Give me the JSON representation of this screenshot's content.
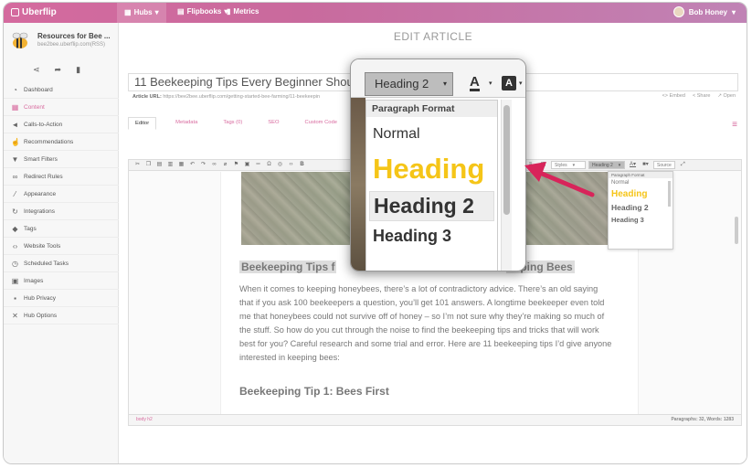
{
  "topbar": {
    "brand": "Uberflip",
    "nav": [
      {
        "label": "Hubs"
      },
      {
        "label": "Flipbooks"
      },
      {
        "label": "Metrics"
      }
    ],
    "user_name": "Bob Honey"
  },
  "sidebar": {
    "hub_title": "Resources for Bee ...",
    "hub_url": "bee2bee.uberflip.com(RSS)",
    "items": [
      {
        "label": "Dashboard",
        "icon": "dashboard-icon"
      },
      {
        "label": "Content",
        "icon": "grid-icon",
        "active": true
      },
      {
        "label": "Calls-to-Action",
        "icon": "megaphone-icon"
      },
      {
        "label": "Recommendations",
        "icon": "thumbs-up-icon"
      },
      {
        "label": "Smart Filters",
        "icon": "filter-icon"
      },
      {
        "label": "Redirect Rules",
        "icon": "link-icon"
      },
      {
        "label": "Appearance",
        "icon": "brush-icon"
      },
      {
        "label": "Integrations",
        "icon": "sync-icon"
      },
      {
        "label": "Tags",
        "icon": "tag-icon"
      },
      {
        "label": "Website Tools",
        "icon": "code-icon"
      },
      {
        "label": "Scheduled Tasks",
        "icon": "clock-icon"
      },
      {
        "label": "Images",
        "icon": "image-icon"
      },
      {
        "label": "Hub Privacy",
        "icon": "lock-icon"
      },
      {
        "label": "Hub Options",
        "icon": "wrench-icon"
      }
    ]
  },
  "main": {
    "page_title": "EDIT ARTICLE",
    "article_title": "11 Beekeeping Tips Every Beginner Shou",
    "url_label": "Article URL:",
    "url_value": "https://bee2bee.uberflip.com/getting-started-bee-farming/11-beekeepin",
    "url_actions": [
      "<> Embed",
      "< Share",
      "↗ Open"
    ],
    "tabs": [
      {
        "label": "Editor",
        "active": true
      },
      {
        "label": "Metadata"
      },
      {
        "label": "Tags (0)"
      },
      {
        "label": "SEO"
      },
      {
        "label": "Custom Code"
      }
    ],
    "toolbar": {
      "styles_label": "Styles",
      "format_label": "Heading 2",
      "source_label": "Source"
    },
    "mini_dropdown": {
      "header": "Paragraph Format",
      "options": [
        "Normal",
        "Heading",
        "Heading 2",
        "Heading 3"
      ]
    },
    "content": {
      "heading_left": "Beekeeping Tips f",
      "heading_right": "eeping Bees",
      "paragraph": "When it comes to keeping honeybees, there’s a lot of contradictory advice. There’s an old saying that if you ask 100 beekeepers a question, you’ll get 101 answers. A longtime beekeeper even told me that honeybees could not survive off of honey – so I’m not sure why they’re making so much of the stuff. So how do you cut through the noise to find the beekeeping tips and tricks that will work best for you? Careful research and some trial and error. Here are 11 beekeeping tips I’d give anyone interested in keeping bees:",
      "heading_tip1": "Beekeeping Tip 1: Bees First"
    },
    "status": {
      "path": "body   h2",
      "stats": "Paragraphs: 32, Words: 1283"
    }
  },
  "zoom": {
    "combo_label": "Heading 2",
    "header": "Paragraph Format",
    "options": [
      "Normal",
      "Heading",
      "Heading 2",
      "Heading 3"
    ]
  },
  "colors": {
    "accent": "#d86b9f",
    "heading_yellow": "#f5c518",
    "arrow": "#d8245a"
  }
}
